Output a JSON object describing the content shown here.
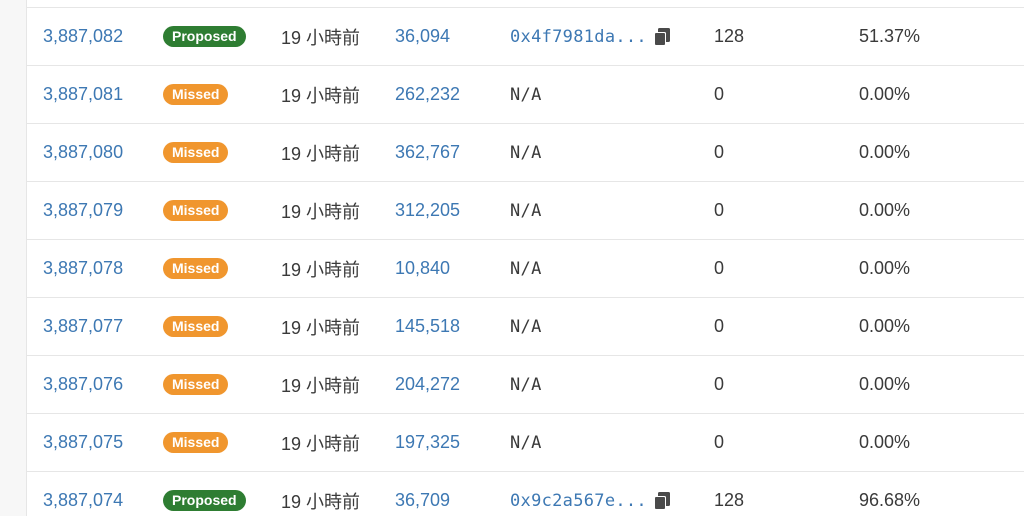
{
  "rows": [
    {
      "slot": "3,887,082",
      "status": "Proposed",
      "status_kind": "proposed",
      "age": "19 小時前",
      "block": "36,094",
      "root": "0x4f7981da...",
      "root_copy": true,
      "attestations": "128",
      "participation": "51.37%"
    },
    {
      "slot": "3,887,081",
      "status": "Missed",
      "status_kind": "missed",
      "age": "19 小時前",
      "block": "262,232",
      "root": "N/A",
      "root_copy": false,
      "attestations": "0",
      "participation": "0.00%"
    },
    {
      "slot": "3,887,080",
      "status": "Missed",
      "status_kind": "missed",
      "age": "19 小時前",
      "block": "362,767",
      "root": "N/A",
      "root_copy": false,
      "attestations": "0",
      "participation": "0.00%"
    },
    {
      "slot": "3,887,079",
      "status": "Missed",
      "status_kind": "missed",
      "age": "19 小時前",
      "block": "312,205",
      "root": "N/A",
      "root_copy": false,
      "attestations": "0",
      "participation": "0.00%"
    },
    {
      "slot": "3,887,078",
      "status": "Missed",
      "status_kind": "missed",
      "age": "19 小時前",
      "block": "10,840",
      "root": "N/A",
      "root_copy": false,
      "attestations": "0",
      "participation": "0.00%"
    },
    {
      "slot": "3,887,077",
      "status": "Missed",
      "status_kind": "missed",
      "age": "19 小時前",
      "block": "145,518",
      "root": "N/A",
      "root_copy": false,
      "attestations": "0",
      "participation": "0.00%"
    },
    {
      "slot": "3,887,076",
      "status": "Missed",
      "status_kind": "missed",
      "age": "19 小時前",
      "block": "204,272",
      "root": "N/A",
      "root_copy": false,
      "attestations": "0",
      "participation": "0.00%"
    },
    {
      "slot": "3,887,075",
      "status": "Missed",
      "status_kind": "missed",
      "age": "19 小時前",
      "block": "197,325",
      "root": "N/A",
      "root_copy": false,
      "attestations": "0",
      "participation": "0.00%"
    },
    {
      "slot": "3,887,074",
      "status": "Proposed",
      "status_kind": "proposed",
      "age": "19 小時前",
      "block": "36,709",
      "root": "0x9c2a567e...",
      "root_copy": true,
      "attestations": "128",
      "participation": "96.68%"
    }
  ],
  "icons": {
    "copy": "copy-icon"
  },
  "colors": {
    "link": "#3d78b3",
    "proposed": "#2e7d32",
    "missed": "#f0962e"
  }
}
